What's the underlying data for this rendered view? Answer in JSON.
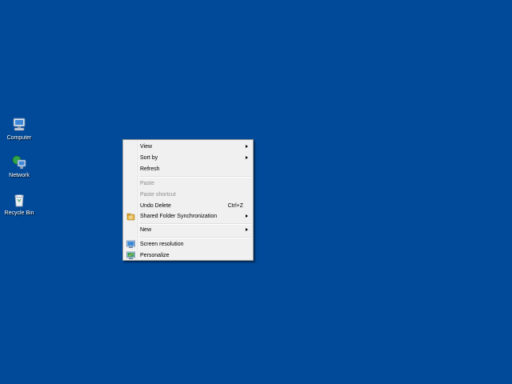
{
  "desktop": {
    "background": "#004a99",
    "icons": [
      {
        "label": "Computer",
        "icon": "computer-icon"
      },
      {
        "label": "Network",
        "icon": "network-icon"
      },
      {
        "label": "Recycle Bin",
        "icon": "recycle-bin-icon"
      }
    ]
  },
  "context_menu": {
    "items": [
      {
        "label": "View",
        "submenu": true
      },
      {
        "label": "Sort by",
        "submenu": true
      },
      {
        "label": "Refresh"
      },
      {
        "label": "Paste",
        "disabled": true
      },
      {
        "label": "Paste shortcut",
        "disabled": true
      },
      {
        "label": "Undo Delete",
        "shortcut": "Ctrl+Z"
      },
      {
        "label": "Shared Folder Synchronization",
        "submenu": true,
        "icon": "sync-folder-icon"
      },
      {
        "label": "New",
        "submenu": true
      },
      {
        "label": "Screen resolution",
        "icon": "screen-resolution-icon"
      },
      {
        "label": "Personalize",
        "icon": "personalize-icon"
      }
    ]
  }
}
